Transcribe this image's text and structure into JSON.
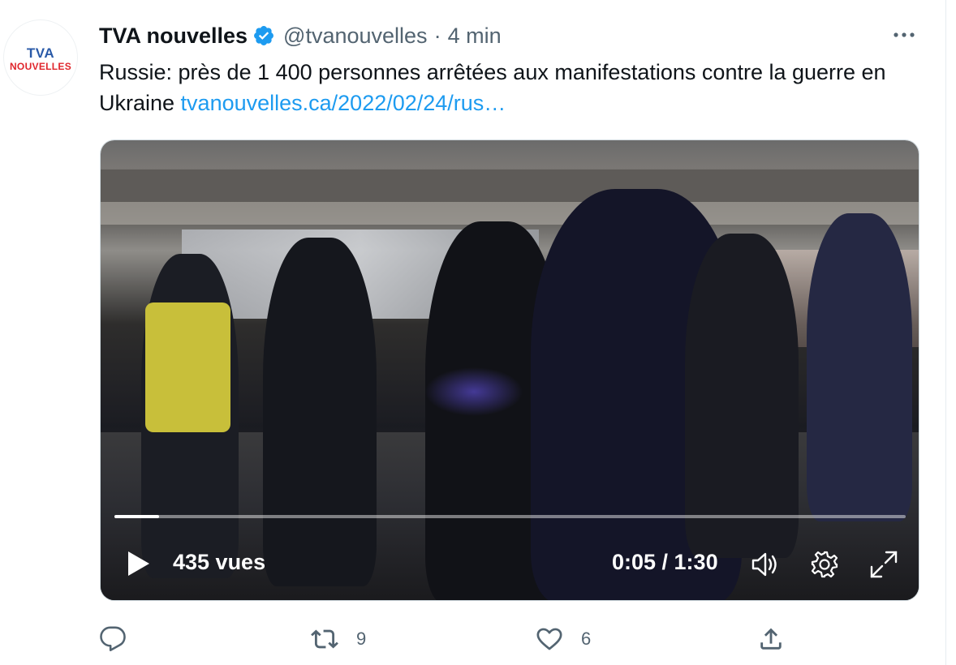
{
  "tweet": {
    "author": {
      "name": "TVA nouvelles",
      "handle": "@tvanouvelles",
      "separator": "·",
      "time": "4 min",
      "verified": true,
      "avatar_logo_top": "TVA",
      "avatar_logo_bottom": "NOUVELLES"
    },
    "text": "Russie: près de 1 400 personnes arrêtées aux manifestations contre la guerre en Ukraine ",
    "link": "tvanouvelles.ca/2022/02/24/rus…",
    "more_icon": "more-horizontal-icon",
    "video": {
      "views": "435 vues",
      "timecode": "0:05 / 1:30",
      "progress": 0.056,
      "icons": [
        "play-icon",
        "volume-icon",
        "settings-gear-icon",
        "fullscreen-icon"
      ]
    },
    "actions": {
      "reply_count": "",
      "retweet_count": "9",
      "like_count": "6",
      "icons": [
        "reply-icon",
        "retweet-icon",
        "like-heart-icon",
        "share-icon"
      ]
    },
    "colors": {
      "link": "#1d9bf0",
      "verified": "#1d9bf0",
      "secondary_text": "#536471",
      "logo_blue": "#2a5aa8",
      "logo_red": "#e0262c"
    }
  }
}
